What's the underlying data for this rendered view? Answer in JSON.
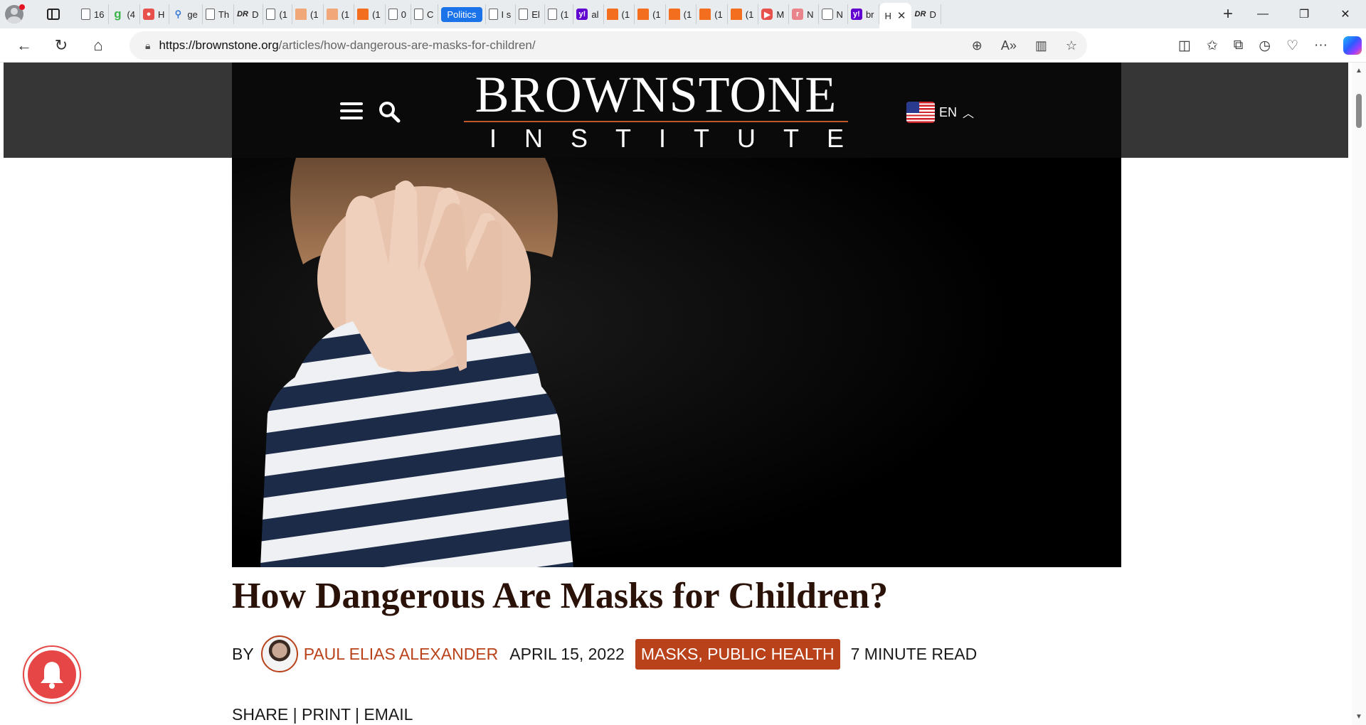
{
  "browser": {
    "tabs": [
      {
        "icon": "page-icon",
        "label": "16"
      },
      {
        "icon": "grammarly-icon",
        "label": "(4"
      },
      {
        "icon": "app-icon",
        "label": "H"
      },
      {
        "icon": "search-icon",
        "label": "ge"
      },
      {
        "icon": "page-icon",
        "label": "Th"
      },
      {
        "icon": "drudge-icon",
        "label": "D"
      },
      {
        "icon": "page-icon",
        "label": "(1"
      },
      {
        "icon": "bookmark-icon",
        "label": "(1"
      },
      {
        "icon": "bookmark-icon",
        "label": "(1"
      },
      {
        "icon": "substack-icon",
        "label": "(1"
      },
      {
        "icon": "page-icon",
        "label": "0"
      },
      {
        "icon": "page-icon",
        "label": "C"
      },
      {
        "icon": "highlight-pill",
        "label": "Politics"
      },
      {
        "icon": "page-icon",
        "label": "I s"
      },
      {
        "icon": "page-icon",
        "label": "El"
      },
      {
        "icon": "page-icon",
        "label": "(1"
      },
      {
        "icon": "yahoo-icon",
        "label": "al"
      },
      {
        "icon": "substack-icon",
        "label": "(1"
      },
      {
        "icon": "substack-icon",
        "label": "(1"
      },
      {
        "icon": "substack-icon",
        "label": "(1"
      },
      {
        "icon": "substack-icon",
        "label": "(1"
      },
      {
        "icon": "substack-icon",
        "label": "(1"
      },
      {
        "icon": "youtube-icon",
        "label": "M"
      },
      {
        "icon": "r-icon",
        "label": "N"
      },
      {
        "icon": "calendar-icon",
        "label": "N"
      },
      {
        "icon": "yahoo-icon",
        "label": "br"
      }
    ],
    "active_tab": {
      "label": "H",
      "close": "✕"
    },
    "after_tab": {
      "icon": "drudge-icon",
      "label": "D"
    },
    "url_host": "https://brownstone.org",
    "url_path": "/articles/how-dangerous-are-masks-for-children/"
  },
  "site": {
    "logo_line1": "BROWNSTONE",
    "logo_line2": "INSTITUTE",
    "language": "EN"
  },
  "article": {
    "title": "How Dangerous Are Masks for Children?",
    "by": "BY",
    "author": "PAUL ELIAS ALEXANDER",
    "date": "APRIL 15, 2022",
    "tags": "MASKS, PUBLIC HEALTH",
    "read_time": "7 MINUTE READ",
    "share": "SHARE",
    "print": "PRINT",
    "email": "EMAIL",
    "sep": "|"
  },
  "colors": {
    "accent": "#b9421a",
    "title": "#2a1208",
    "header_bar": "#363636",
    "bell": "#e64646"
  }
}
